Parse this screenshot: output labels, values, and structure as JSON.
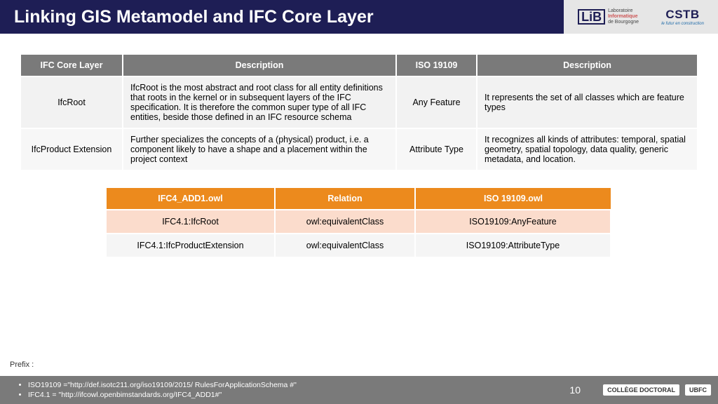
{
  "header": {
    "title": "Linking GIS Metamodel and IFC Core Layer",
    "logos": {
      "lib_mark": "LiB",
      "lib_line1": "Laboratoire",
      "lib_line2": "Informatique",
      "lib_line3": "de Bourgogne",
      "cstb_big": "CSTB",
      "cstb_small": "le futur en construction"
    }
  },
  "table1": {
    "headers": [
      "IFC Core Layer",
      "Description",
      "ISO 19109",
      "Description"
    ],
    "rows": [
      {
        "ifc": "IfcRoot",
        "desc": "IfcRoot is the most abstract and root class for all entity definitions that roots in the kernel or in subsequent layers of the IFC specification. It is therefore the common super type of all IFC entities, beside those defined in an IFC resource schema",
        "iso": "Any Feature",
        "iso_desc": "It represents the set of all classes which are feature types"
      },
      {
        "ifc": "IfcProduct Extension",
        "desc": "Further specializes the concepts of a (physical) product, i.e. a component likely to have a shape and a placement within the project context",
        "iso": "Attribute Type",
        "iso_desc": "It recognizes all kinds of attributes: temporal, spatial geometry, spatial topology, data quality, generic metadata, and location."
      }
    ]
  },
  "table2": {
    "headers": [
      "IFC4_ADD1.owl",
      "Relation",
      "ISO 19109.owl"
    ],
    "rows": [
      {
        "a": "IFC4.1:IfcRoot",
        "b": "owl:equivalentClass",
        "c": "ISO19109:AnyFeature"
      },
      {
        "a": "IFC4.1:IfcProductExtension",
        "b": "owl:equivalentClass",
        "c": "ISO19109:AttributeType"
      }
    ]
  },
  "prefix_label": "Prefix :",
  "footer": {
    "lines": [
      "ISO19109 =\"http://def.isotc211.org/iso19109/2015/ RulesForApplicationSchema #\"",
      "IFC4.1 = \"http://ifcowl.openbimstandards.org/IFC4_ADD1#\""
    ],
    "page": "10",
    "logo1": "COLLÈGE DOCTORAL",
    "logo2": "UBFC"
  }
}
